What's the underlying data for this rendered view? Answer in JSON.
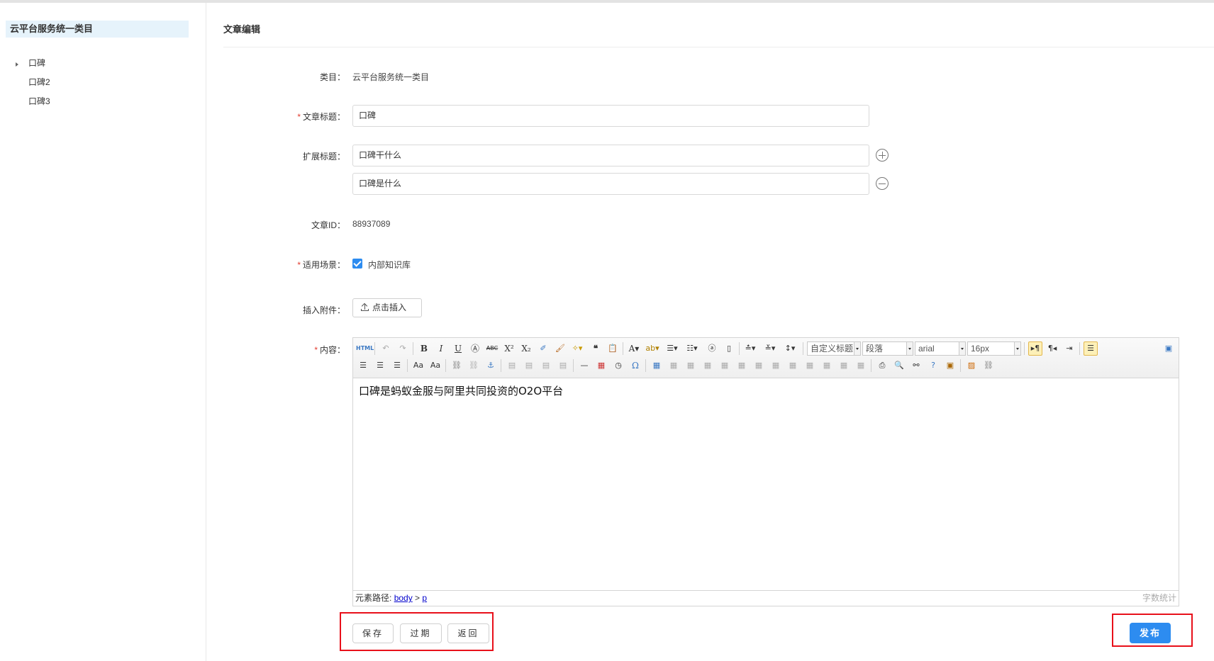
{
  "sidebar": {
    "title": "云平台服务统一类目",
    "items": [
      {
        "label": "口碑"
      },
      {
        "label": "口碑2"
      },
      {
        "label": "口碑3"
      }
    ]
  },
  "page": {
    "title": "文章编辑"
  },
  "form": {
    "category": {
      "label": "类目：",
      "value": "云平台服务统一类目"
    },
    "title": {
      "label": "文章标题：",
      "value": "口碑"
    },
    "ext_title": {
      "label": "扩展标题：",
      "values": [
        "口碑干什么",
        "口碑是什么"
      ]
    },
    "article_id": {
      "label": "文章ID：",
      "value": "88937089"
    },
    "scene": {
      "label": "适用场景：",
      "option": "内部知识库",
      "checked": true
    },
    "attachment": {
      "label": "插入附件：",
      "button": "点击插入"
    },
    "content": {
      "label": "内容："
    }
  },
  "editor": {
    "font_style": "自定义标题",
    "paragraph": "段落",
    "font_family": "arial",
    "font_size": "16px",
    "body": "口碑是蚂蚁金服与阿里共同投资的O2O平台",
    "path_label": "元素路径:",
    "path_body": "body",
    "path_sep": " > ",
    "path_p": "p",
    "word_count": "字数统计"
  },
  "actions": {
    "save": "保存",
    "expire": "过期",
    "back": "返回",
    "publish": "发布"
  },
  "colors": {
    "primary": "#2d8cf0",
    "highlight": "#e8101a",
    "required": "#e23c2f"
  }
}
